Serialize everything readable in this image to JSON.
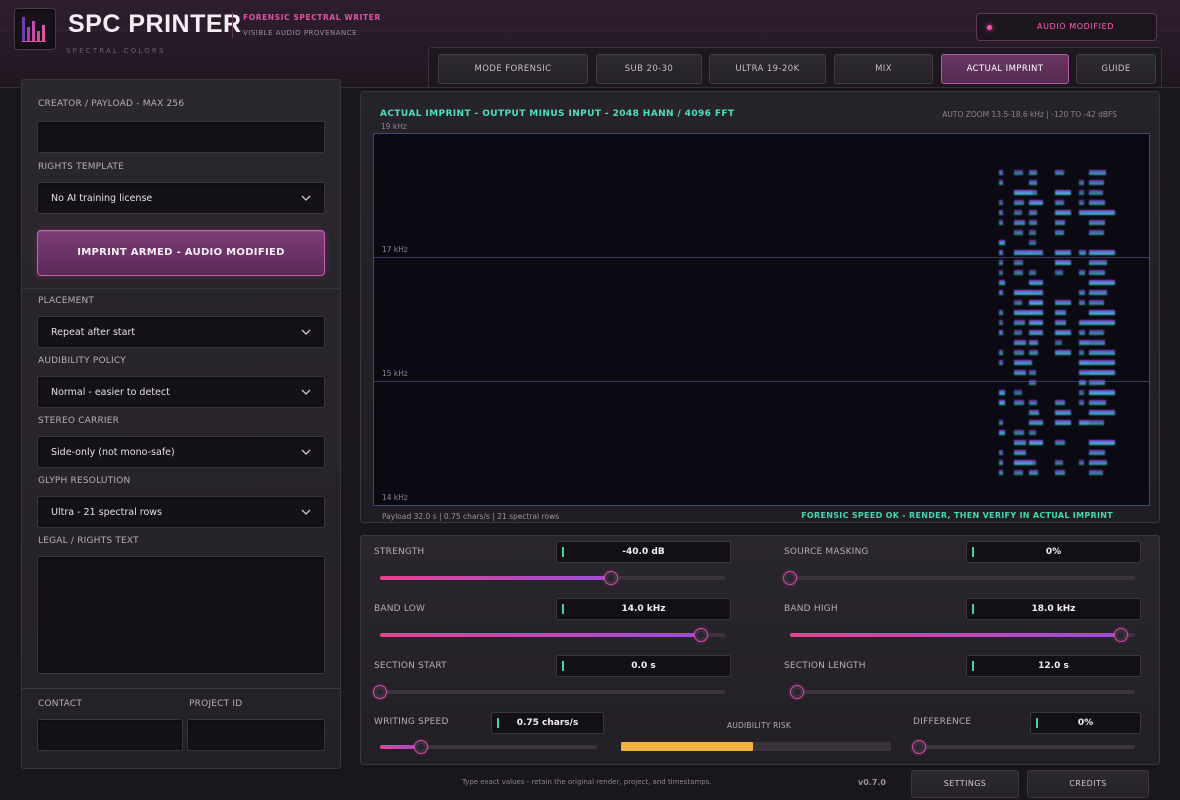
{
  "app": {
    "title": "SPC PRINTER",
    "tagline": "SPECTRAL COLORS",
    "subtitle": "FORENSIC SPECTRAL WRITER",
    "subtitle2": "VISIBLE AUDIO PROVENANCE",
    "status": "AUDIO MODIFIED"
  },
  "tabs": [
    {
      "label": "MODE  FORENSIC",
      "active": false
    },
    {
      "label": "SUB 20-30",
      "active": false
    },
    {
      "label": "ULTRA 19-20K",
      "active": false
    },
    {
      "label": "MIX",
      "active": false
    },
    {
      "label": "ACTUAL IMPRINT",
      "active": true
    },
    {
      "label": "GUIDE",
      "active": false
    }
  ],
  "left": {
    "payload_label": "CREATOR / PAYLOAD - MAX 256",
    "payload_value": "",
    "rights_label": "RIGHTS TEMPLATE",
    "rights_value": "No AI training license",
    "imprint_button": "IMPRINT ARMED - AUDIO MODIFIED",
    "placement_label": "PLACEMENT",
    "placement_value": "Repeat after start",
    "audibility_label": "AUDIBILITY POLICY",
    "audibility_value": "Normal - easier to detect",
    "stereo_label": "STEREO CARRIER",
    "stereo_value": "Side-only (not mono-safe)",
    "glyph_label": "GLYPH RESOLUTION",
    "glyph_value": "Ultra - 21 spectral rows",
    "legal_label": "LEGAL / RIGHTS TEXT",
    "legal_value": "",
    "contact_label": "CONTACT",
    "contact_value": "",
    "project_label": "PROJECT ID",
    "project_value": ""
  },
  "spectrogram": {
    "title": "ACTUAL IMPRINT - OUTPUT MINUS INPUT - 2048 HANN / 4096 FFT",
    "zoom": "AUTO ZOOM 13.5-18.6 kHz | -120 TO -42 dBFS",
    "freq_labels": [
      "19 kHz",
      "17 kHz",
      "15 kHz",
      "14 kHz"
    ],
    "footer_left": "Payload 32.0 s  |  0.75 chars/s  |  21 spectral rows",
    "footer_right": "FORENSIC SPEED OK - RENDER, THEN VERIFY IN ACTUAL IMPRINT"
  },
  "controls": {
    "strength": {
      "label": "STRENGTH",
      "value": "-40.0 dB",
      "fraction": 0.67
    },
    "source_masking": {
      "label": "SOURCE MASKING",
      "value": "0%",
      "fraction": 0.0
    },
    "band_low": {
      "label": "BAND LOW",
      "value": "14.0 kHz",
      "fraction": 0.93
    },
    "band_high": {
      "label": "BAND HIGH",
      "value": "18.0 kHz",
      "fraction": 0.96
    },
    "section_start": {
      "label": "SECTION START",
      "value": "0.0 s",
      "fraction": 0.0
    },
    "section_length": {
      "label": "SECTION LENGTH",
      "value": "12.0 s",
      "fraction": 0.02
    },
    "writing_speed": {
      "label": "WRITING SPEED",
      "value": "0.75 chars/s",
      "fraction": 0.19
    },
    "audibility_risk": {
      "label": "AUDIBILITY RISK",
      "fraction": 0.49
    },
    "difference": {
      "label": "DIFFERENCE",
      "value": "0%",
      "fraction": 0.0
    }
  },
  "footer": {
    "note": "Type exact values - retain the original render, project, and timestamps.",
    "version": "v0.7.0",
    "settings": "SETTINGS",
    "credits": "CREDITS"
  },
  "colors": {
    "accent": "#d64ca6",
    "teal": "#4ee0bc",
    "risk": "#f2b33e"
  }
}
